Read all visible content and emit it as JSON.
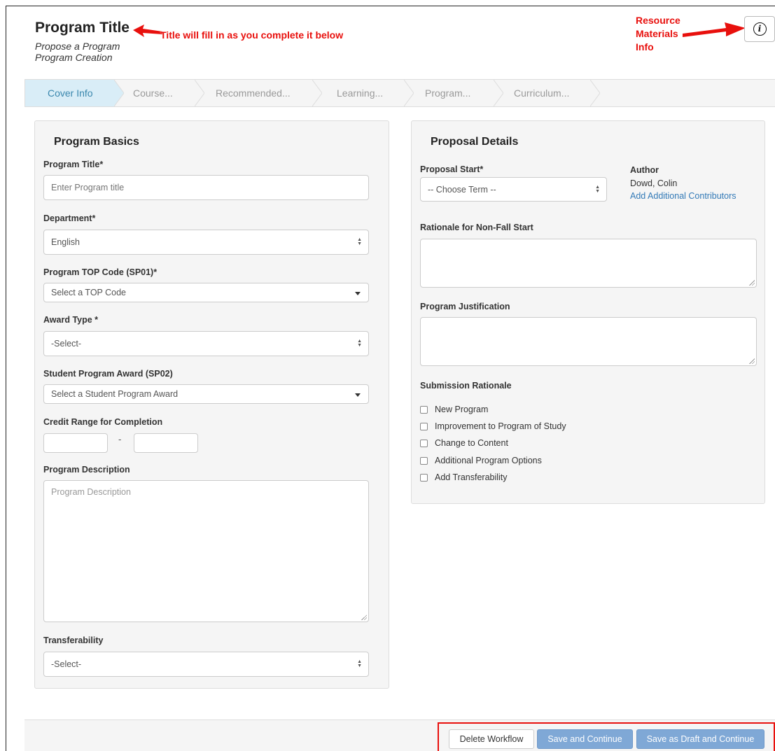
{
  "header": {
    "title": "Program Title",
    "subtitle_1": "Propose a Program",
    "subtitle_2": "Program Creation"
  },
  "annotations": {
    "title_note": "Title will fill in as you complete it below",
    "resource_note_line1": "Resource",
    "resource_note_line2": "Materials",
    "resource_note_line3": "Info",
    "color": "#e8100d"
  },
  "info_button": {
    "icon": "info-circle-icon",
    "glyph": "i"
  },
  "wizard": {
    "steps": [
      {
        "label": "Cover Info",
        "active": true
      },
      {
        "label": "Course...",
        "active": false
      },
      {
        "label": "Recommended...",
        "active": false
      },
      {
        "label": "Learning...",
        "active": false
      },
      {
        "label": "Program...",
        "active": false
      },
      {
        "label": "Curriculum...",
        "active": false
      }
    ]
  },
  "program_basics": {
    "heading": "Program Basics",
    "program_title": {
      "label": "Program Title*",
      "placeholder": "Enter Program title",
      "value": ""
    },
    "department": {
      "label": "Department*",
      "value": "English"
    },
    "top_code": {
      "label": "Program TOP Code (SP01)*",
      "value": "Select a TOP Code"
    },
    "award_type": {
      "label": "Award Type *",
      "value": "-Select-"
    },
    "student_award": {
      "label": "Student Program Award (SP02)",
      "value": "Select a Student Program Award"
    },
    "credit_range": {
      "label": "Credit Range for Completion",
      "separator": "-",
      "min": "",
      "max": ""
    },
    "description": {
      "label": "Program Description",
      "placeholder": "Program Description",
      "value": ""
    },
    "transferability": {
      "label": "Transferability",
      "value": "-Select-"
    }
  },
  "proposal_details": {
    "heading": "Proposal Details",
    "proposal_start": {
      "label": "Proposal Start*",
      "value": "-- Choose Term --"
    },
    "author": {
      "label": "Author",
      "name": "Dowd, Colin",
      "link": "Add Additional Contributors"
    },
    "rationale_nonfall": {
      "label": "Rationale for Non-Fall Start",
      "value": ""
    },
    "justification": {
      "label": "Program Justification",
      "value": ""
    },
    "submission_rationale": {
      "label": "Submission Rationale",
      "options": [
        {
          "label": "New Program",
          "checked": false
        },
        {
          "label": "Improvement to Program of Study",
          "checked": false
        },
        {
          "label": "Change to Content",
          "checked": false
        },
        {
          "label": "Additional Program Options",
          "checked": false
        },
        {
          "label": "Add Transferability",
          "checked": false
        }
      ]
    }
  },
  "footer": {
    "delete_label": "Delete Workflow",
    "save_label": "Save and Continue",
    "draft_label": "Save as Draft and Continue"
  },
  "colors": {
    "annotation_red": "#e8100d",
    "active_step_bg": "#d9edf7",
    "active_step_text": "#3a87ad",
    "link_blue": "#337ab7",
    "primary_button": "#7fa8d6"
  }
}
